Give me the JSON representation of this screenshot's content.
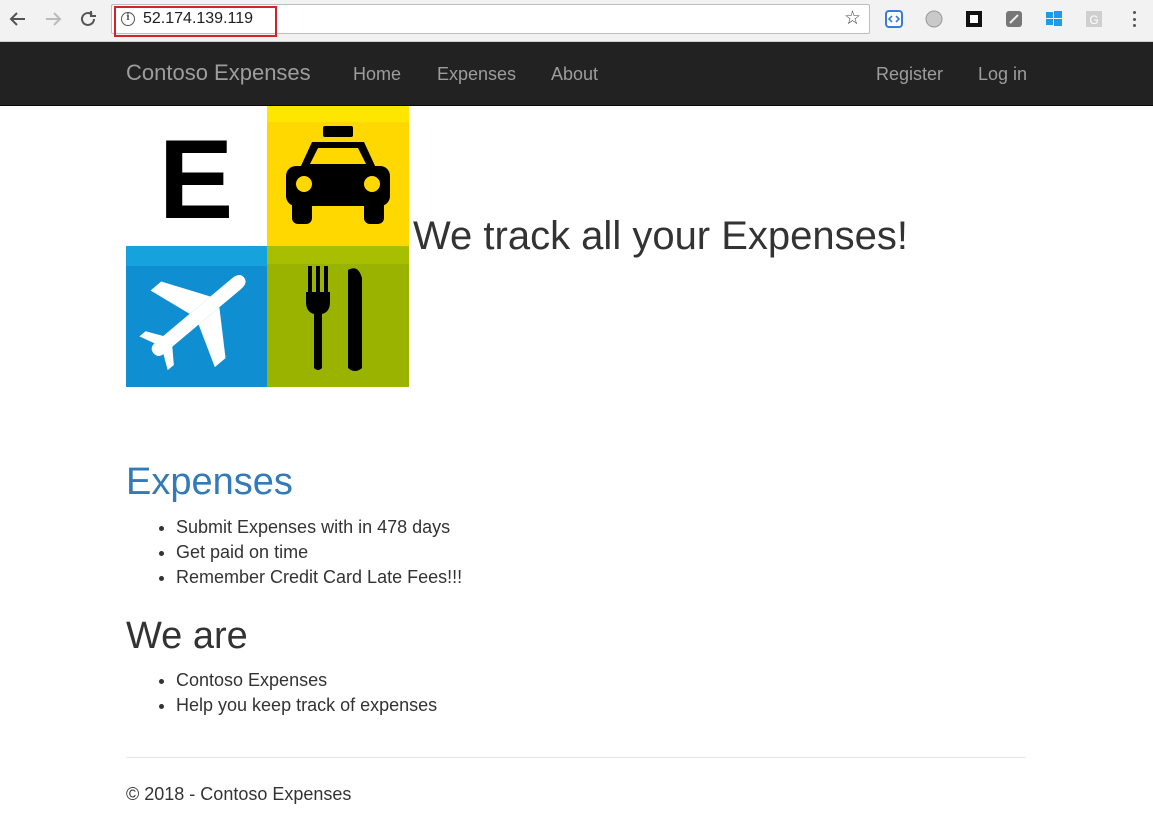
{
  "browser": {
    "url": "52.174.139.119",
    "icons": [
      "back-arrow-icon",
      "forward-arrow-icon",
      "reload-icon",
      "info-icon",
      "star-icon",
      "menu-icon"
    ]
  },
  "navbar": {
    "brand": "Contoso Expenses",
    "links": [
      "Home",
      "Expenses",
      "About"
    ],
    "right_links": [
      "Register",
      "Log in"
    ],
    "background": "#222222",
    "link_color": "#9d9d9d"
  },
  "hero": {
    "logo_letter": "E",
    "heading": "We track all your Expenses!",
    "tile_colors": [
      "#ffffff",
      "#ffd800",
      "#0f8ed2",
      "#9ab300"
    ]
  },
  "sections": {
    "expenses": {
      "title": "Expenses",
      "items": [
        "Submit Expenses with in 478 days",
        "Get paid on time",
        "Remember Credit Card Late Fees!!!"
      ],
      "title_color": "#337ab7"
    },
    "we_are": {
      "title": "We are",
      "items": [
        "Contoso Expenses",
        "Help you keep track of expenses"
      ]
    }
  },
  "footer": {
    "text": "© 2018 - Contoso Expenses"
  }
}
